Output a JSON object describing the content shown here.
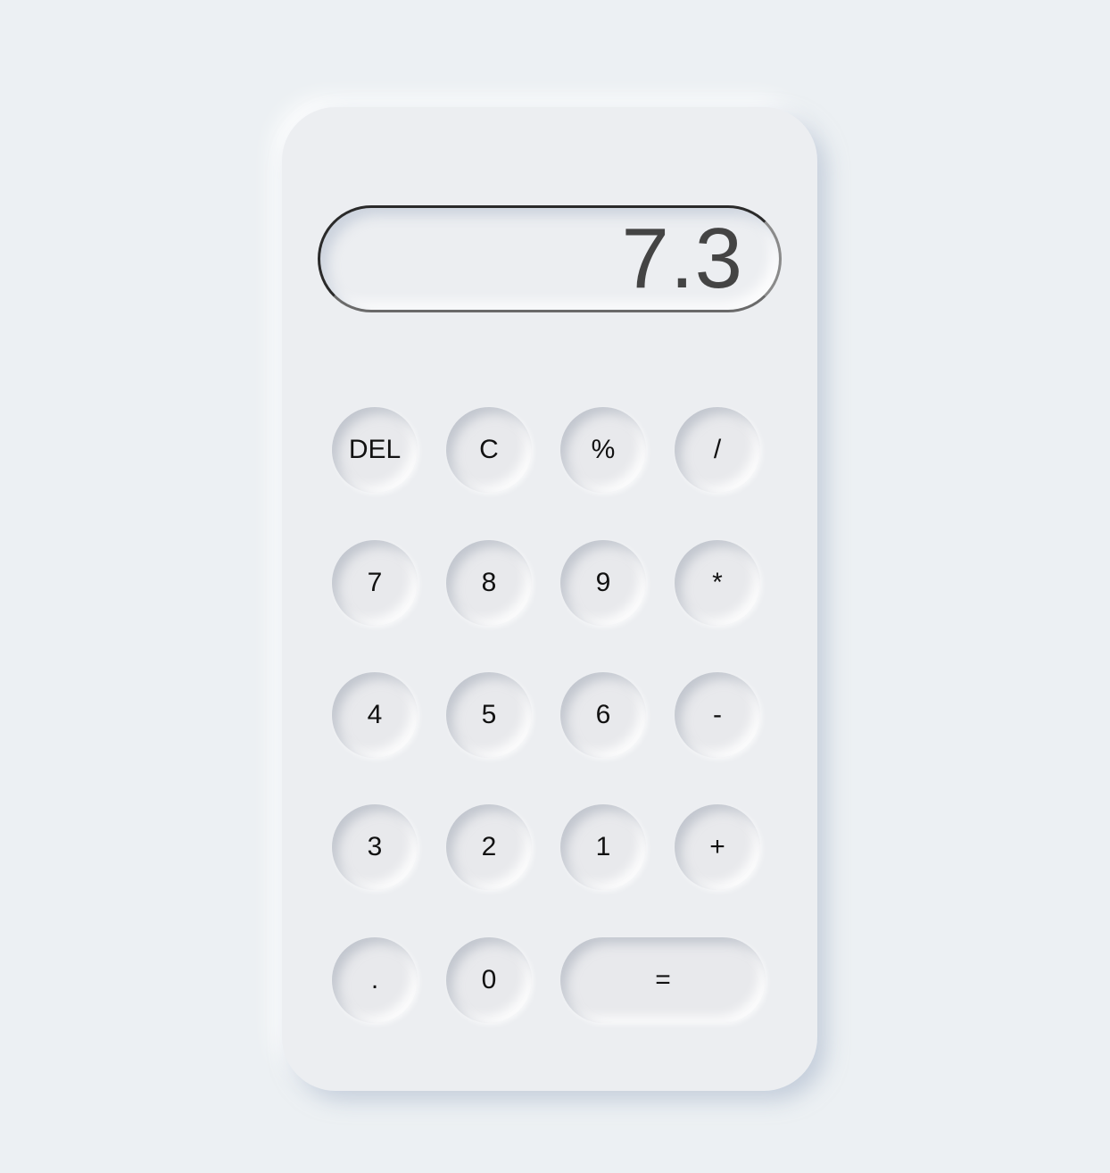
{
  "display": {
    "value": "7.3"
  },
  "keys": {
    "del": "DEL",
    "clear": "C",
    "percent": "%",
    "divide": "/",
    "seven": "7",
    "eight": "8",
    "nine": "9",
    "multiply": "*",
    "four": "4",
    "five": "5",
    "six": "6",
    "minus": "-",
    "three": "3",
    "two": "2",
    "one": "1",
    "plus": "+",
    "decimal": ".",
    "zero": "0",
    "equals": "="
  },
  "colors": {
    "background": "#ecf0f3",
    "body": "#eceef1",
    "key": "#e8e9ec",
    "display_text": "#444444",
    "key_text": "#111111"
  }
}
